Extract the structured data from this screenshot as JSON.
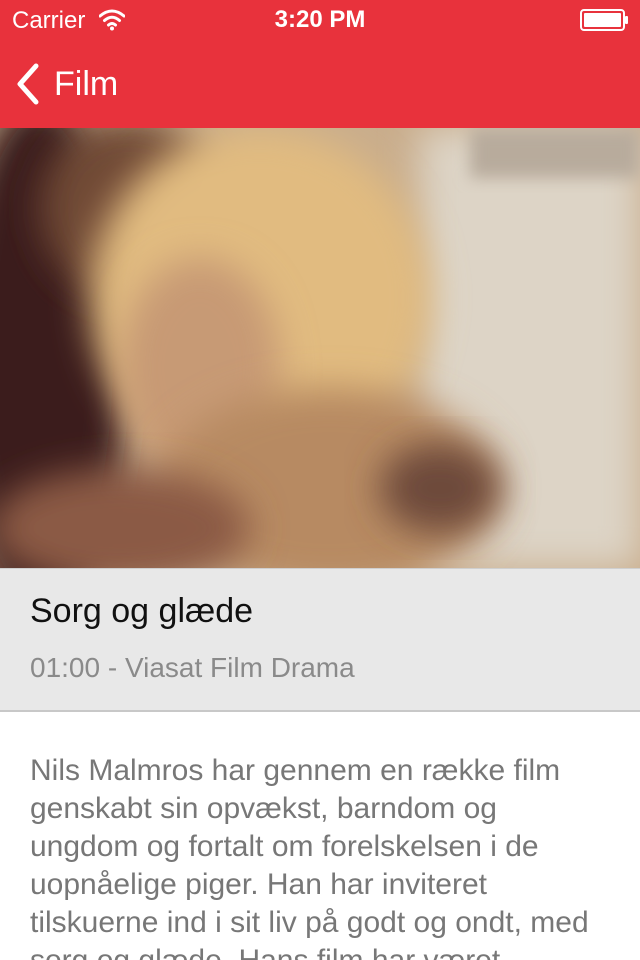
{
  "status_bar": {
    "carrier": "Carrier",
    "time": "3:20 PM",
    "wifi_icon": "wifi-icon",
    "battery_icon": "battery-icon"
  },
  "nav": {
    "back_label": "Film",
    "back_icon": "chevron-left-icon",
    "bar_color": "#e8323c"
  },
  "program": {
    "title": "Sorg og glæde",
    "subtitle": "01:00 - Viasat Film Drama",
    "description": "Nils Malmros har gennem en række film genskabt sin opvækst, barndom og ungdom og fortalt om forelskelsen i de uopnåelige piger. Han har inviteret tilskuerne ind i sit liv på godt og ondt, med sorg og glæde. Hans film har været"
  }
}
